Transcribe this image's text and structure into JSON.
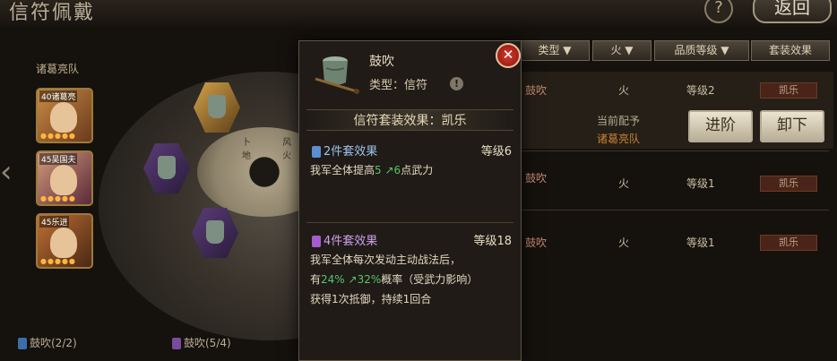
{
  "header": {
    "title": "信符佩戴",
    "help": "?",
    "back": "返回"
  },
  "left": {
    "team_label": "诸葛亮队",
    "heroes": [
      {
        "label": "40诸葛亮"
      },
      {
        "label": "45吴国夫"
      },
      {
        "label": "45乐进"
      }
    ]
  },
  "wheel": {
    "center_glyphs": "卜 风 地 火"
  },
  "tabs": [
    "类型 ▼",
    "火 ▼",
    "品质等级 ▼",
    "套装效果"
  ],
  "rows": [
    {
      "name": "鼓吹",
      "attr": "火",
      "level": "等级2",
      "tag": "凯乐",
      "equip_status": "当前配予",
      "equip_team": "诸葛亮队"
    },
    {
      "name": "鼓吹",
      "attr": "火",
      "level": "等级1",
      "tag": "凯乐"
    },
    {
      "name": "鼓吹",
      "attr": "火",
      "level": "等级1",
      "tag": "凯乐"
    }
  ],
  "actions": {
    "advance": "进阶",
    "unequip": "卸下"
  },
  "bottom": [
    {
      "text": "鼓吹(2/2)",
      "color": "#3b6ea8"
    },
    {
      "text": "鼓吹(5/4)",
      "color": "#7a4a9e"
    }
  ],
  "popup": {
    "name": "鼓吹",
    "type": "类型：信符",
    "set_title": "信符套装效果：凯乐",
    "effects": [
      {
        "title": "2件套效果",
        "level": "等级6",
        "icon_color": "#5a8fd1",
        "line1_pre": "我军全体提高",
        "from": "5",
        "arrow": "↗",
        "to": "6",
        "line1_post": "点武力"
      },
      {
        "title": "4件套效果",
        "level": "等级18",
        "icon_color": "#a65bd1",
        "line1": "我军全体每次发动主动战法后，",
        "line2_pre": "有",
        "from": "24%",
        "arrow": "↗",
        "to": "32%",
        "line2_post": "概率（受武力影响）",
        "line3": "获得1次抵御，持续1回合"
      }
    ]
  },
  "colors": {
    "accent_green": "#56c46a",
    "title_gold": "#d9a85b",
    "close_red": "#c3281c"
  }
}
